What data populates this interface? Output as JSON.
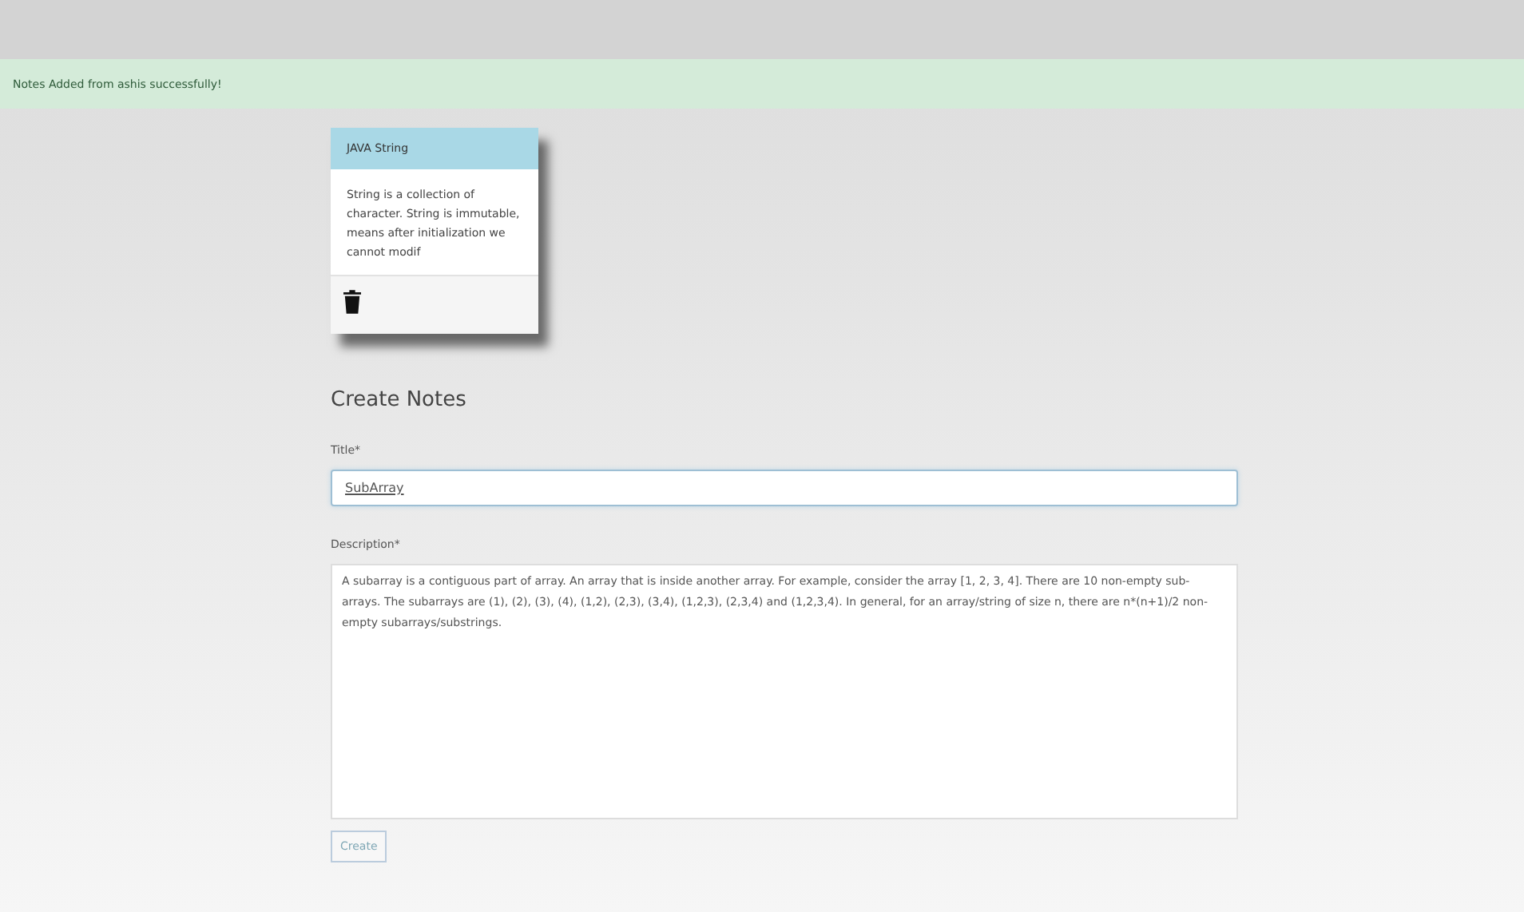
{
  "alert": {
    "message": "Notes Added from ashis successfully!"
  },
  "notes": [
    {
      "title": "JAVA String",
      "body": "String is a collection of character. String is immutable, means after initialization we cannot modif"
    }
  ],
  "form": {
    "heading": "Create Notes",
    "title_label": "Title*",
    "title_value": "SubArray",
    "description_label": "Description*",
    "description_value": "A subarray is a contiguous part of array. An array that is inside another array. For example, consider the array [1, 2, 3, 4]. There are 10 non-empty sub-arrays. The subarrays are (1), (2), (3), (4), (1,2), (2,3), (3,4), (1,2,3), (2,3,4) and (1,2,3,4). In general, for an array/string of size n, there are n*(n+1)/2 non-empty subarrays/substrings.",
    "submit": "Create"
  }
}
